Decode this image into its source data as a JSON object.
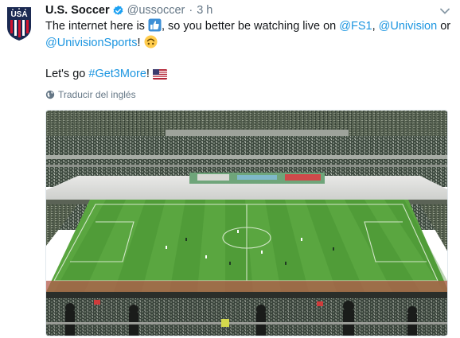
{
  "tweet": {
    "display_name": "U.S. Soccer",
    "handle": "@ussoccer",
    "separator": "·",
    "time": "3 h",
    "text": {
      "line1_a": "The internet here is",
      "line1_b": ", so you better be watching live on",
      "mention_fs1": "@FS1",
      "comma": ",",
      "mention_univision": "@Univision",
      "or": "or",
      "mention_univision_sports": "@UnivisionSports",
      "exclaim": "!",
      "line3_a": "Let's go",
      "hashtag": "#Get3More",
      "exclaim2": "!"
    },
    "translate_label": "Traducir del inglés",
    "logo_text": "USA"
  },
  "icons": {
    "verified": "verified-badge-icon",
    "caret": "chevron-down-icon",
    "globe": "globe-icon",
    "thumbs_up": "thumbs-up-emoji",
    "upside_down": "upside-down-face-emoji",
    "flag": "us-flag-emoji"
  },
  "colors": {
    "link": "#1b95e0",
    "text": "#14171a",
    "muted": "#657786",
    "verified": "#1da1f2"
  }
}
